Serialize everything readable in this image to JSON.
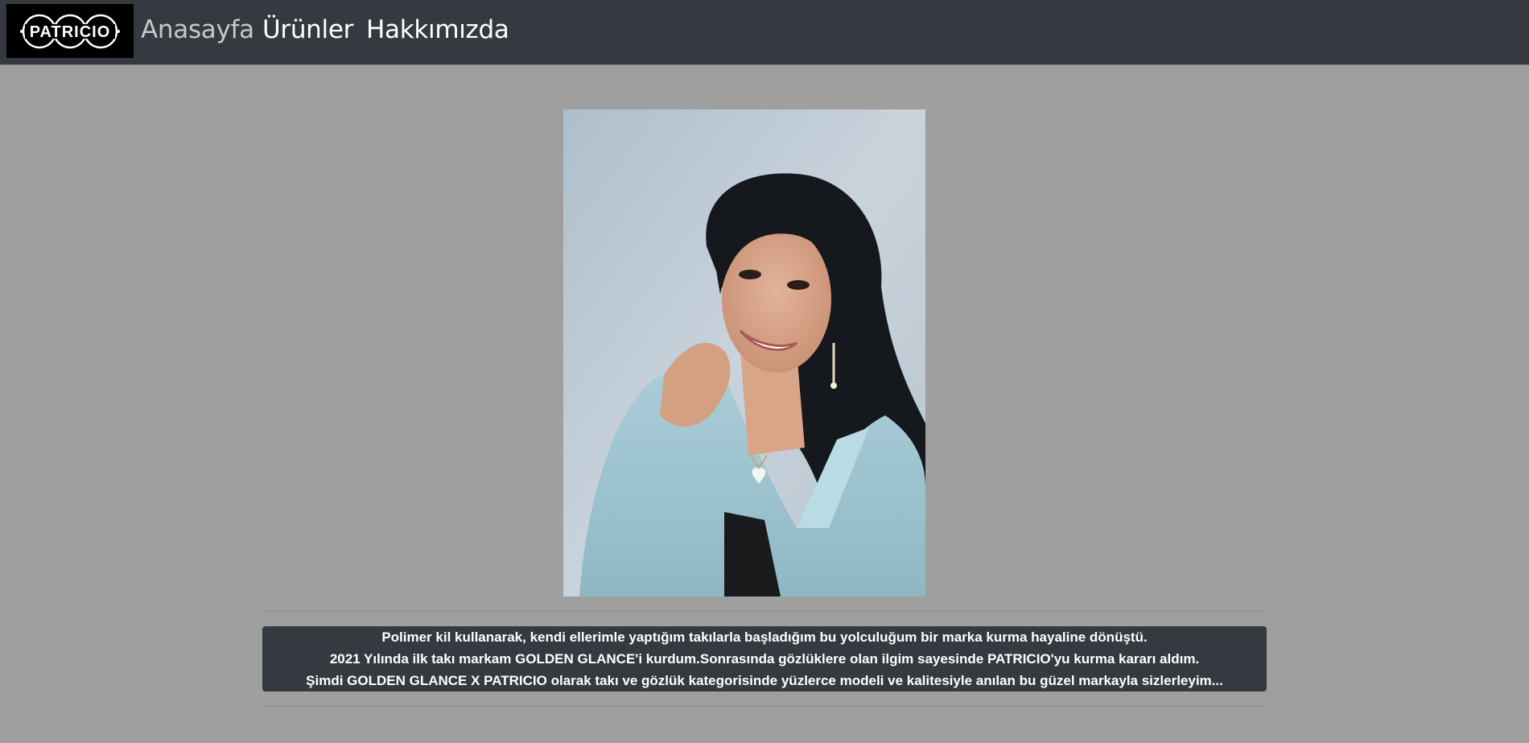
{
  "brand": {
    "logo_text": "PATRICIO"
  },
  "nav": {
    "home": "Anasayfa",
    "products": "Ürünler",
    "about": "Hakkımızda"
  },
  "hero": {
    "photo_alt": "portrait-photo"
  },
  "about": {
    "lines": [
      "Polimer kil kullanarak, kendi ellerimle yaptığım takılarla başladığım bu yolculuğum bir marka kurma hayaline dönüştü.",
      "2021 Yılında ilk takı markam GOLDEN GLANCE'i kurdum.Sonrasında gözlüklere olan ilgim sayesinde PATRICIO'yu kurma kararı aldım.",
      "Şimdi GOLDEN GLANCE X PATRICIO olarak takı ve gözlük kategorisinde yüzlerce modeli ve kalitesiyle anılan bu güzel markayla sizlerleyim..."
    ]
  },
  "colors": {
    "navbar": "#343a40",
    "page_background": "#9f9f9f",
    "text_box": "#343a40",
    "nav_active": "#c6c8ca"
  }
}
